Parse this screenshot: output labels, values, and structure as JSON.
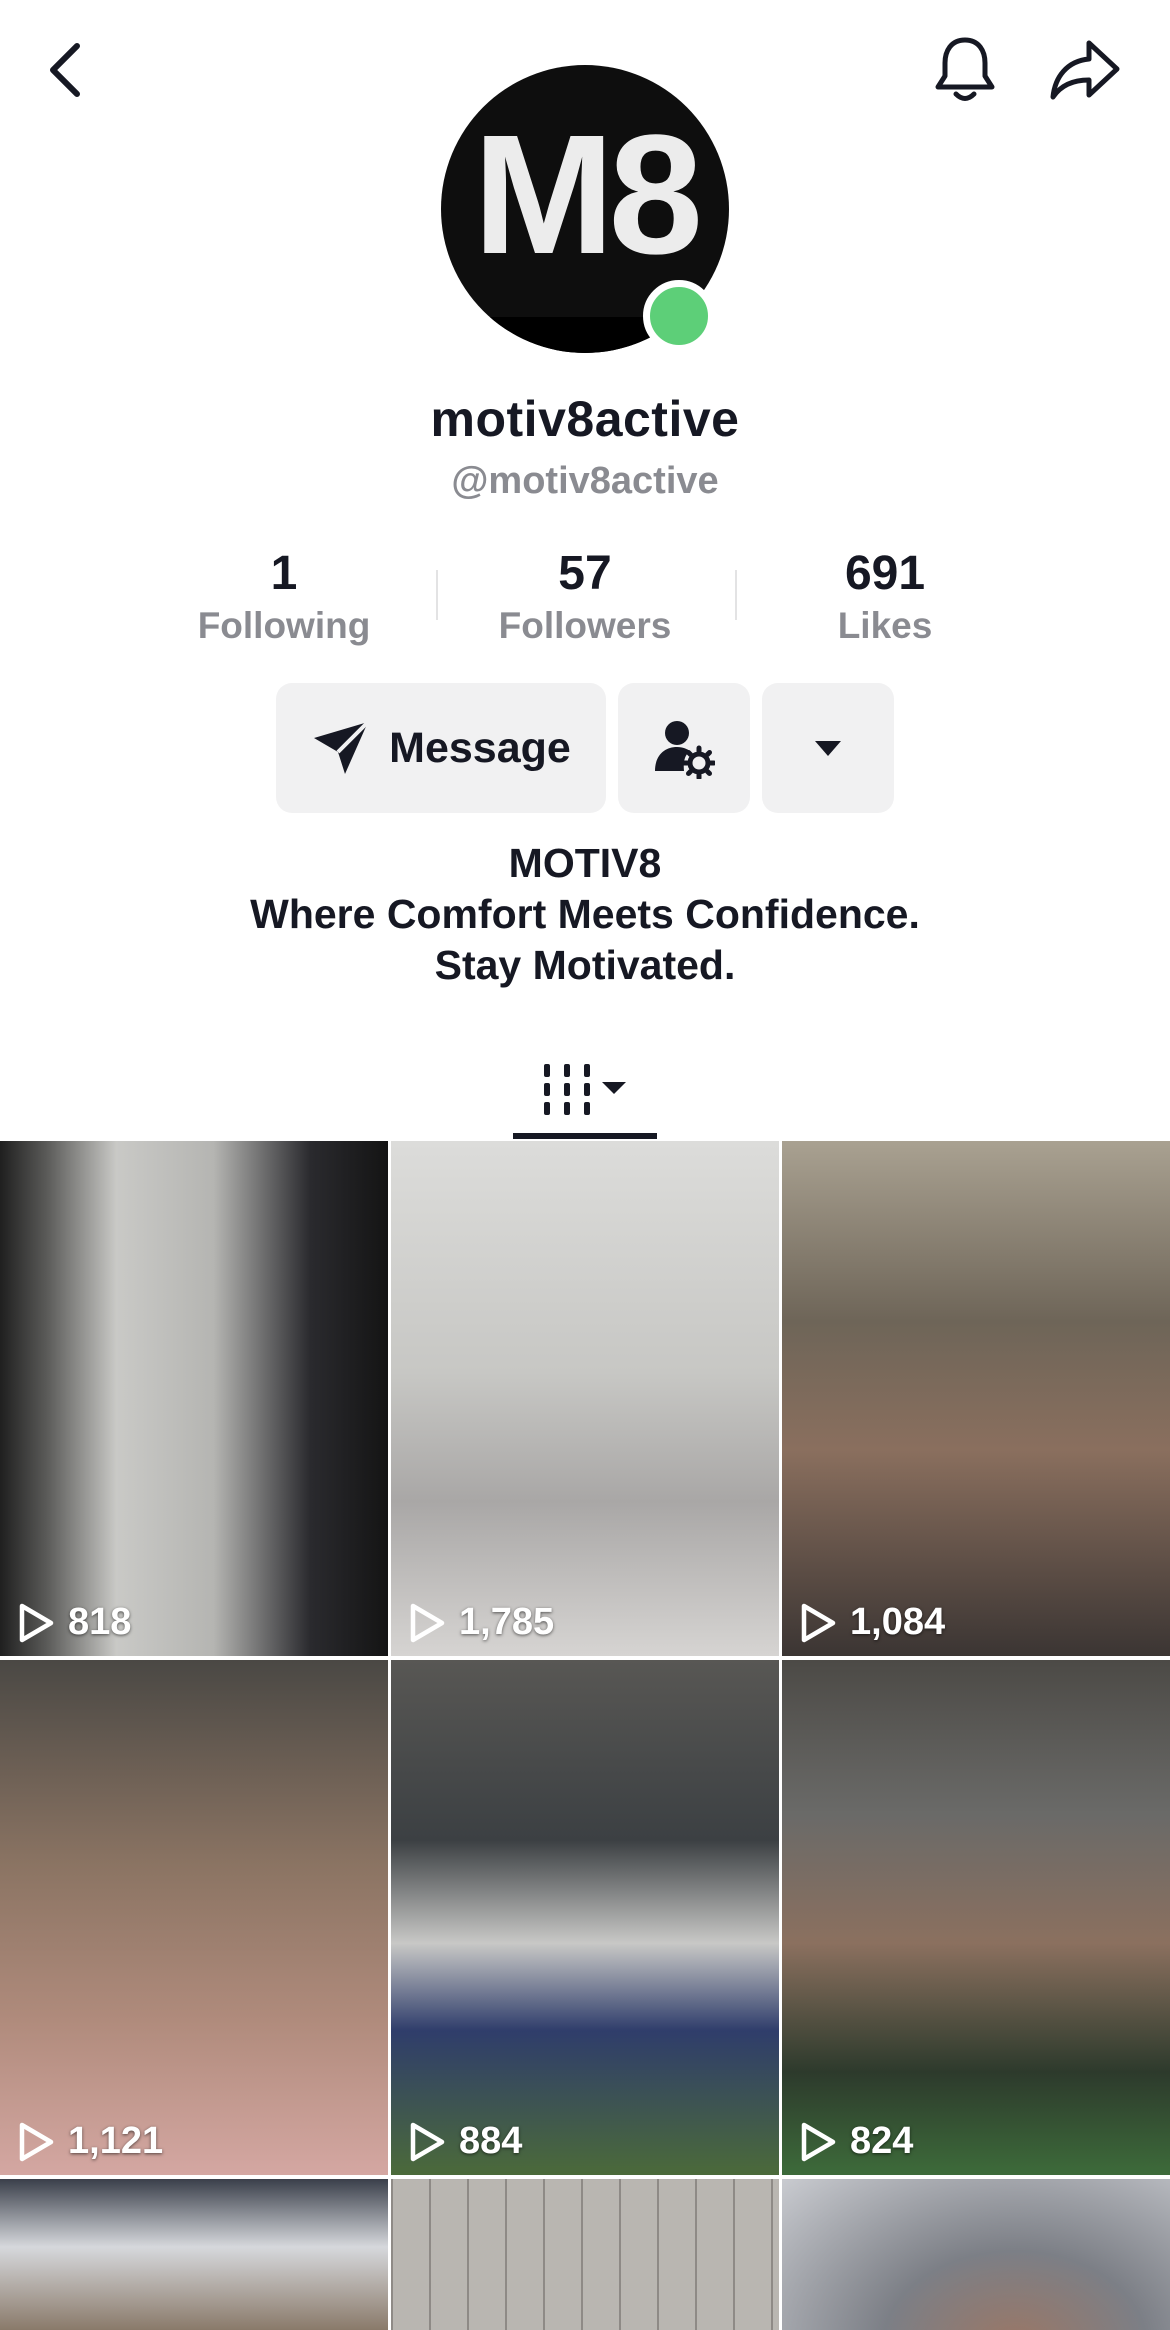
{
  "profile": {
    "display_name": "motiv8active",
    "username": "@motiv8active",
    "avatar_text": "M8",
    "live_color": "#5dcf78"
  },
  "stats": {
    "following": {
      "value": "1",
      "label": "Following"
    },
    "followers": {
      "value": "57",
      "label": "Followers"
    },
    "likes": {
      "value": "691",
      "label": "Likes"
    }
  },
  "actions": {
    "message_label": "Message"
  },
  "bio": {
    "line1": "MOTIV8",
    "line2": "Where Comfort Meets Confidence.",
    "line3": "Stay Motivated."
  },
  "tabs": {
    "active": "videos"
  },
  "icons": {
    "back": "chevron-left-icon",
    "bell": "bell-icon",
    "share": "share-arrow-icon",
    "message": "send-icon",
    "add_friend": "person-settings-icon",
    "more": "caret-down-icon",
    "videos_tab": "grid-icon",
    "views": "play-icon"
  },
  "videos": [
    {
      "views": "818"
    },
    {
      "views": "1,785"
    },
    {
      "views": "1,084"
    },
    {
      "views": "1,121"
    },
    {
      "views": "884"
    },
    {
      "views": "824"
    },
    {
      "views": ""
    },
    {
      "views": ""
    },
    {
      "views": ""
    }
  ]
}
